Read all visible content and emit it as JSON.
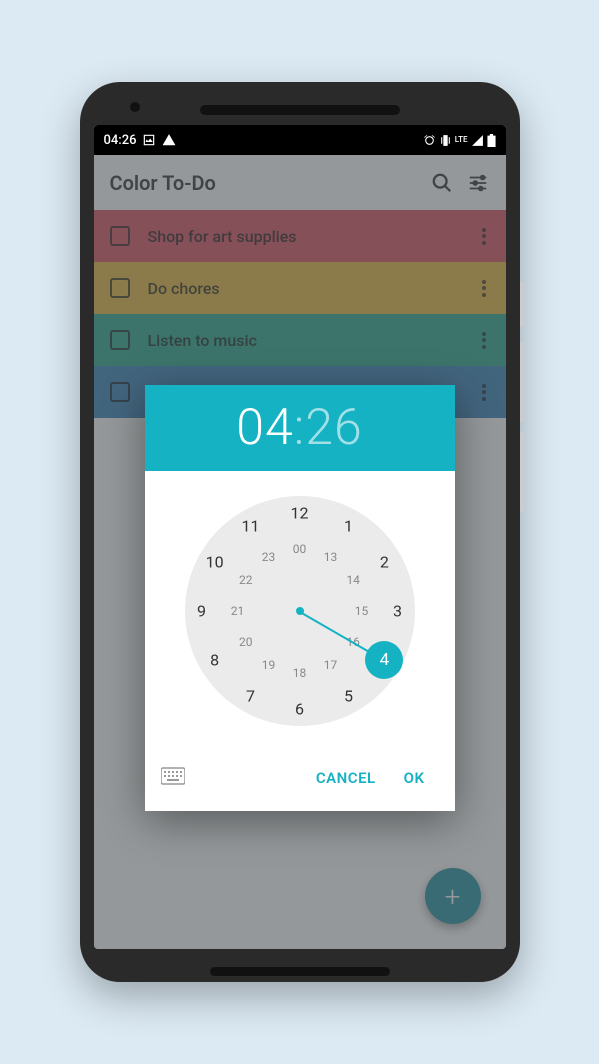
{
  "status": {
    "time": "04:26",
    "indicators": "LTE"
  },
  "app": {
    "title": "Color To-Do"
  },
  "todos": [
    {
      "label": "Shop for art supplies",
      "color": "red"
    },
    {
      "label": "Do chores",
      "color": "yellow"
    },
    {
      "label": "Listen to music",
      "color": "green"
    },
    {
      "label": "",
      "color": "blue"
    }
  ],
  "dialog": {
    "hours": "04",
    "minutes": "26",
    "selected_hour": 4,
    "outer_numbers": [
      "12",
      "1",
      "2",
      "3",
      "4",
      "5",
      "6",
      "7",
      "8",
      "9",
      "10",
      "11"
    ],
    "inner_numbers": [
      "00",
      "13",
      "14",
      "15",
      "16",
      "17",
      "18",
      "19",
      "20",
      "21",
      "22",
      "23"
    ],
    "cancel": "CANCEL",
    "ok": "OK"
  },
  "fab": {
    "symbol": "+"
  }
}
